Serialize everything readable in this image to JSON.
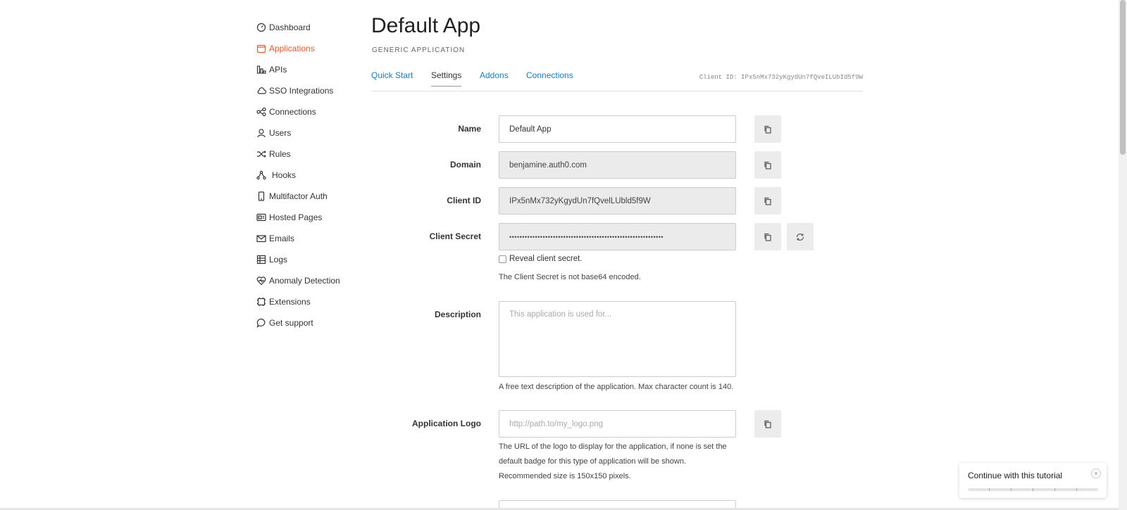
{
  "sidebar": {
    "items": [
      {
        "label": "Dashboard",
        "icon": "dashboard-icon"
      },
      {
        "label": "Applications",
        "icon": "applications-icon",
        "active": true
      },
      {
        "label": "APIs",
        "icon": "apis-icon"
      },
      {
        "label": "SSO Integrations",
        "icon": "cloud-icon"
      },
      {
        "label": "Connections",
        "icon": "connections-icon"
      },
      {
        "label": "Users",
        "icon": "users-icon"
      },
      {
        "label": "Rules",
        "icon": "shuffle-icon"
      },
      {
        "label": "Hooks",
        "icon": "hooks-icon"
      },
      {
        "label": "Multifactor Auth",
        "icon": "phone-icon"
      },
      {
        "label": "Hosted Pages",
        "icon": "hosted-pages-icon"
      },
      {
        "label": "Emails",
        "icon": "mail-icon"
      },
      {
        "label": "Logs",
        "icon": "logs-icon"
      },
      {
        "label": "Anomaly Detection",
        "icon": "heart-icon"
      },
      {
        "label": "Extensions",
        "icon": "extensions-icon"
      },
      {
        "label": "Get support",
        "icon": "chat-icon"
      }
    ]
  },
  "header": {
    "title": "Default App",
    "subtitle": "GENERIC APPLICATION"
  },
  "tabs": {
    "items": [
      {
        "label": "Quick Start"
      },
      {
        "label": "Settings",
        "active": true
      },
      {
        "label": "Addons"
      },
      {
        "label": "Connections"
      }
    ],
    "client_id_text": "Client ID: IPx5nMx732yKgydUn7fQveILUbId5f9W"
  },
  "form": {
    "name": {
      "label": "Name",
      "value": "Default App"
    },
    "domain": {
      "label": "Domain",
      "value": "benjamine.auth0.com"
    },
    "client_id": {
      "label": "Client ID",
      "value": "IPx5nMx732yKgydUn7fQvelLUbld5f9W"
    },
    "client_secret": {
      "label": "Client Secret",
      "value": "••••••••••••••••••••••••••••••••••••••••••••••••••••••••••••",
      "reveal_label": "Reveal client secret.",
      "help": "The Client Secret is not base64 encoded."
    },
    "description": {
      "label": "Description",
      "placeholder": "This application is used for...",
      "help": "A free text description of the application. Max character count is 140."
    },
    "logo": {
      "label": "Application Logo",
      "placeholder": "http://path.to/my_logo.png",
      "help_lines": [
        "The URL of the logo to display for the application, if none is set the",
        "default badge for this type of application will be shown.",
        "Recommended size is 150x150 pixels."
      ]
    }
  },
  "tutorial": {
    "label": "Continue with this tutorial",
    "close_glyph": "×"
  },
  "colors": {
    "accent": "#eb5424",
    "link": "#1a7cbd"
  }
}
